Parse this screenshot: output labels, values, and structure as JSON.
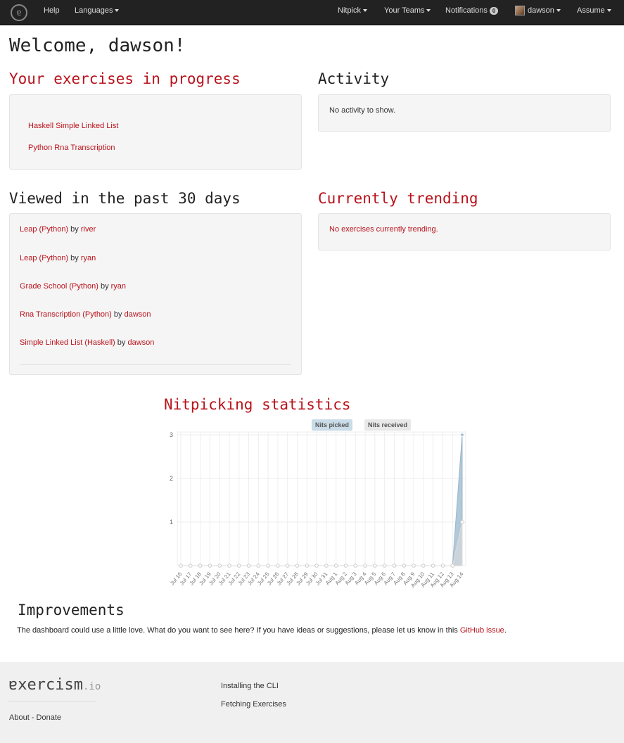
{
  "nav": {
    "logo_glyph": "ɐ",
    "help": "Help",
    "languages": "Languages",
    "nitpick": "Nitpick",
    "teams": "Your Teams",
    "notifications": "Notifications",
    "notifications_count": "0",
    "user": "dawson",
    "assume": "Assume"
  },
  "welcome": "Welcome, dawson!",
  "in_progress": {
    "title": "Your exercises in progress",
    "items": [
      "Haskell Simple Linked List",
      "Python Rna Transcription"
    ]
  },
  "activity": {
    "title": "Activity",
    "empty": "No activity to show."
  },
  "viewed": {
    "title": "Viewed in the past 30 days",
    "by": "by",
    "items": [
      {
        "exercise": "Leap (Python)",
        "user": "river"
      },
      {
        "exercise": "Leap (Python)",
        "user": "ryan"
      },
      {
        "exercise": "Grade School (Python)",
        "user": "ryan"
      },
      {
        "exercise": "Rna Transcription (Python)",
        "user": "dawson"
      },
      {
        "exercise": "Simple Linked List (Haskell)",
        "user": "dawson"
      }
    ]
  },
  "trending": {
    "title": "Currently trending",
    "empty": "No exercises currently trending."
  },
  "stats": {
    "title": "Nitpicking statistics"
  },
  "chart_data": {
    "type": "area",
    "x": [
      "Jul 16",
      "Jul 17",
      "Jul 18",
      "Jul 19",
      "Jul 20",
      "Jul 21",
      "Jul 22",
      "Jul 23",
      "Jul 24",
      "Jul 25",
      "Jul 26",
      "Jul 27",
      "Jul 28",
      "Jul 29",
      "Jul 30",
      "Jul 31",
      "Aug 1",
      "Aug 2",
      "Aug 3",
      "Aug 4",
      "Aug 5",
      "Aug 6",
      "Aug 7",
      "Aug 8",
      "Aug 9",
      "Aug 10",
      "Aug 11",
      "Aug 12",
      "Aug 13",
      "Aug 14"
    ],
    "series": [
      {
        "name": "Nits picked",
        "values": [
          0,
          0,
          0,
          0,
          0,
          0,
          0,
          0,
          0,
          0,
          0,
          0,
          0,
          0,
          0,
          0,
          0,
          0,
          0,
          0,
          0,
          0,
          0,
          0,
          0,
          0,
          0,
          0,
          0,
          3
        ],
        "color": "#97b7cc"
      },
      {
        "name": "Nits received",
        "values": [
          0,
          0,
          0,
          0,
          0,
          0,
          0,
          0,
          0,
          0,
          0,
          0,
          0,
          0,
          0,
          0,
          0,
          0,
          0,
          0,
          0,
          0,
          0,
          0,
          0,
          0,
          0,
          0,
          0,
          1
        ],
        "color": "#dcdcdc"
      }
    ],
    "yticks": [
      1,
      2,
      3
    ],
    "ylim": [
      0,
      3
    ],
    "legend": "top-center",
    "grid": true
  },
  "improvements": {
    "title": "Improvements",
    "text": "The dashboard could use a little love. What do you want to see here? If you have ideas or suggestions, please let us know in this ",
    "link": "GitHub issue",
    "end": "."
  },
  "footer": {
    "logo": "ɐxercism",
    "logo_suffix": ".io",
    "about": "About",
    "sep": " - ",
    "donate": "Donate",
    "cli": "Installing the CLI",
    "fetching": "Fetching Exercises"
  }
}
